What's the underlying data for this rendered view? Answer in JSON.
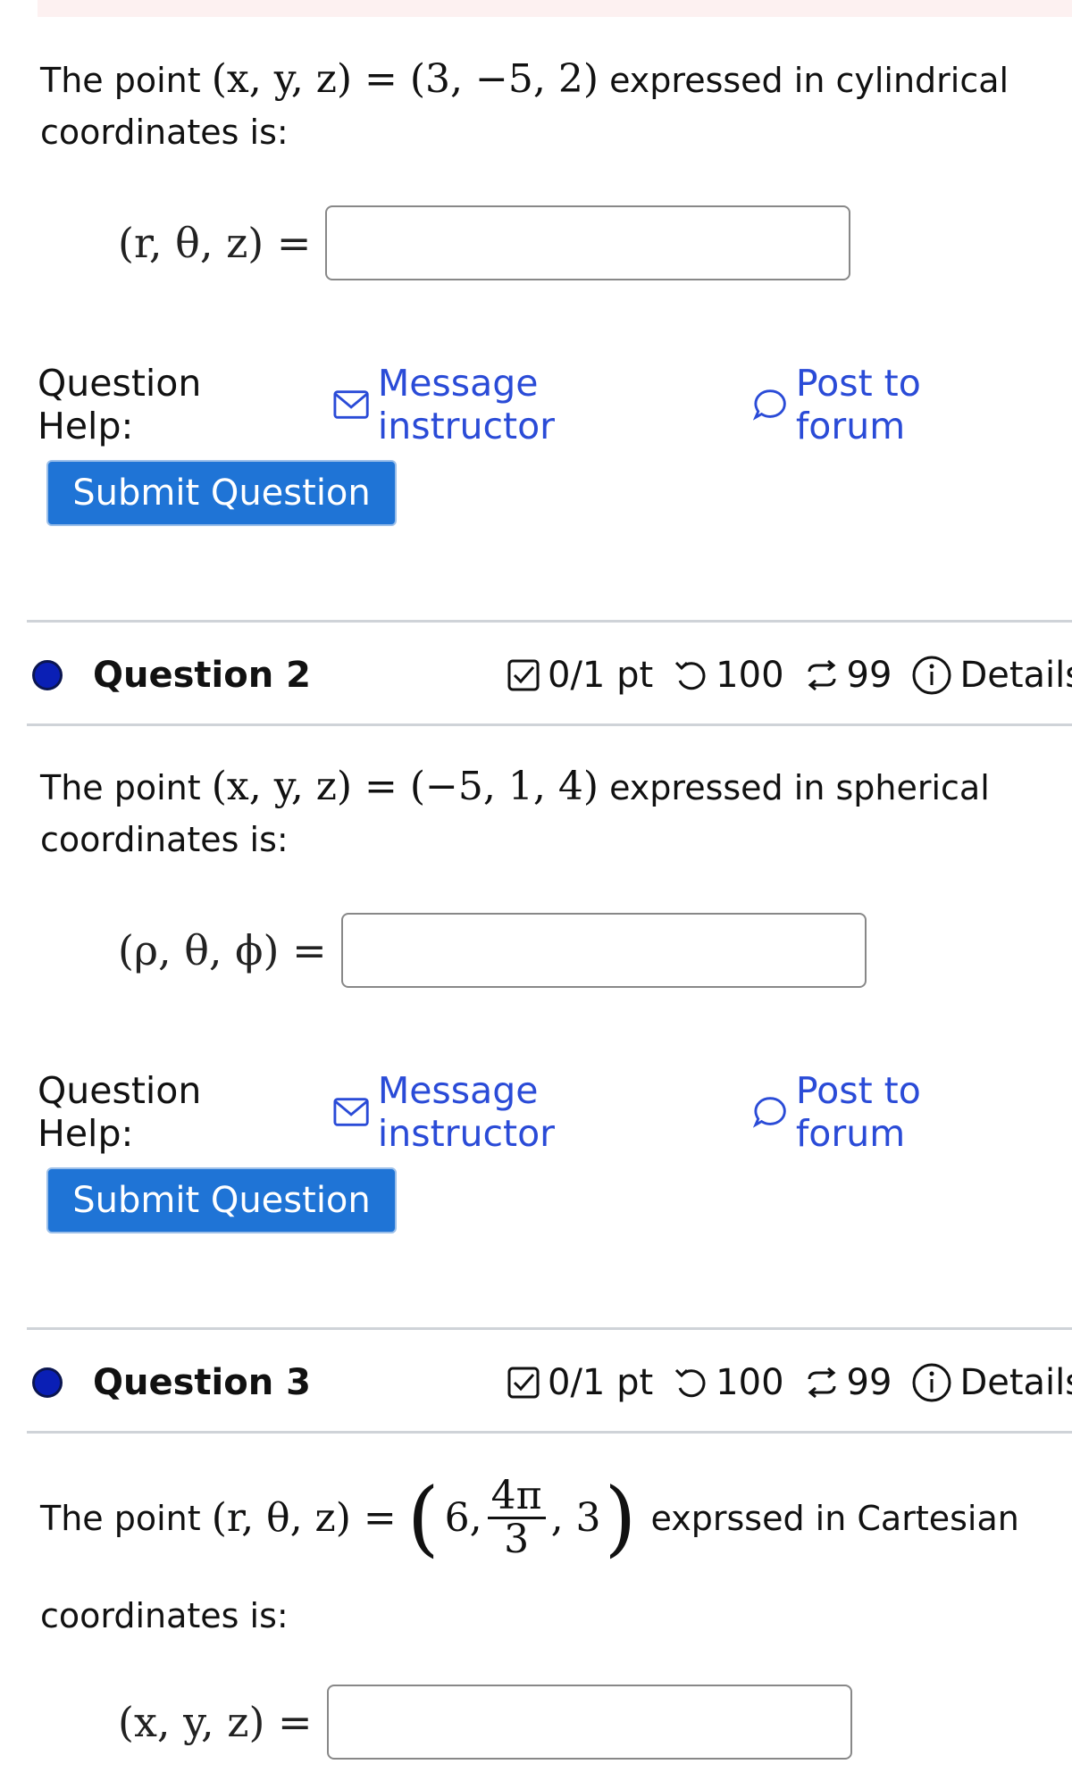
{
  "q1": {
    "prompt_before": "The point ",
    "prompt_math": "(x, y, z) = (3, −5, 2)",
    "prompt_after": " expressed in cylindrical coordinates is:",
    "answer_label": "(r, θ, z) =",
    "answer_value": "",
    "help_label": "Question Help:",
    "message_label": "Message instructor",
    "forum_label": "Post to forum",
    "submit_label": "Submit Question"
  },
  "q2": {
    "title": "Question 2",
    "points": "0/1 pt",
    "retries": "100",
    "attempts": "99",
    "details": "Details",
    "prompt_before": "The point ",
    "prompt_math": "(x, y, z) = (−5, 1, 4)",
    "prompt_after": " expressed in spherical coordinates is:",
    "answer_label": "(ρ, θ, ϕ) =",
    "answer_value": "",
    "help_label": "Question Help:",
    "message_label": "Message instructor",
    "forum_label": "Post to forum",
    "submit_label": "Submit Question"
  },
  "q3": {
    "title": "Question 3",
    "points": "0/1 pt",
    "retries": "100",
    "attempts": "99",
    "details": "Details",
    "prompt_before": "The point ",
    "prompt_math_lhs": "(r, θ, z) =",
    "prompt_math_a": "6,",
    "prompt_math_num": "4π",
    "prompt_math_den": "3",
    "prompt_math_b": ", 3",
    "prompt_after": " exprssed in Cartesian",
    "prompt_line2": "coordinates is:",
    "answer_label": "(x, y, z) =",
    "answer_value": ""
  },
  "colors": {
    "link": "#2a4bd7",
    "submit": "#1f74d6",
    "dot": "#0a1fb5"
  }
}
